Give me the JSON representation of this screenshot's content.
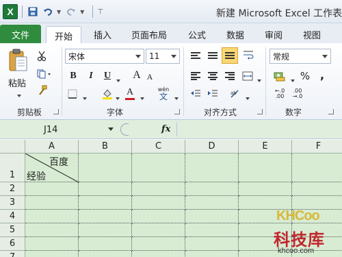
{
  "titlebar": {
    "title": "新建 Microsoft Excel 工作表",
    "app_icon": "X"
  },
  "tabs": [
    "文件",
    "开始",
    "插入",
    "页面布局",
    "公式",
    "数据",
    "审阅",
    "视图"
  ],
  "ribbon": {
    "clipboard": {
      "paste_label": "粘贴",
      "group_label": "剪贴板"
    },
    "font": {
      "font_name": "宋体",
      "font_size": "11",
      "bold": "B",
      "italic": "I",
      "underline": "U",
      "grow": "A",
      "shrink": "A",
      "font_color": "A",
      "phonetic": "wén",
      "group_label": "字体"
    },
    "alignment": {
      "group_label": "对齐方式"
    },
    "number": {
      "format": "常规",
      "percent": "%",
      "comma": ",",
      "group_label": "数字"
    }
  },
  "formula_bar": {
    "name_box": "J14",
    "fx_label": "fx",
    "formula": ""
  },
  "grid": {
    "columns": [
      "A",
      "B",
      "C",
      "D",
      "E",
      "F"
    ],
    "rows": [
      "1",
      "2",
      "3",
      "4",
      "5",
      "6",
      "7"
    ],
    "a1_top": "百度",
    "a1_bottom": "经验"
  },
  "watermark": {
    "brand": "KHCoo",
    "name": "科技库",
    "url": "khcoo.com"
  },
  "colors": {
    "file_tab": "#2f8c3f",
    "grid_bg": "#d7ecd3",
    "accent": "#2a5699"
  }
}
